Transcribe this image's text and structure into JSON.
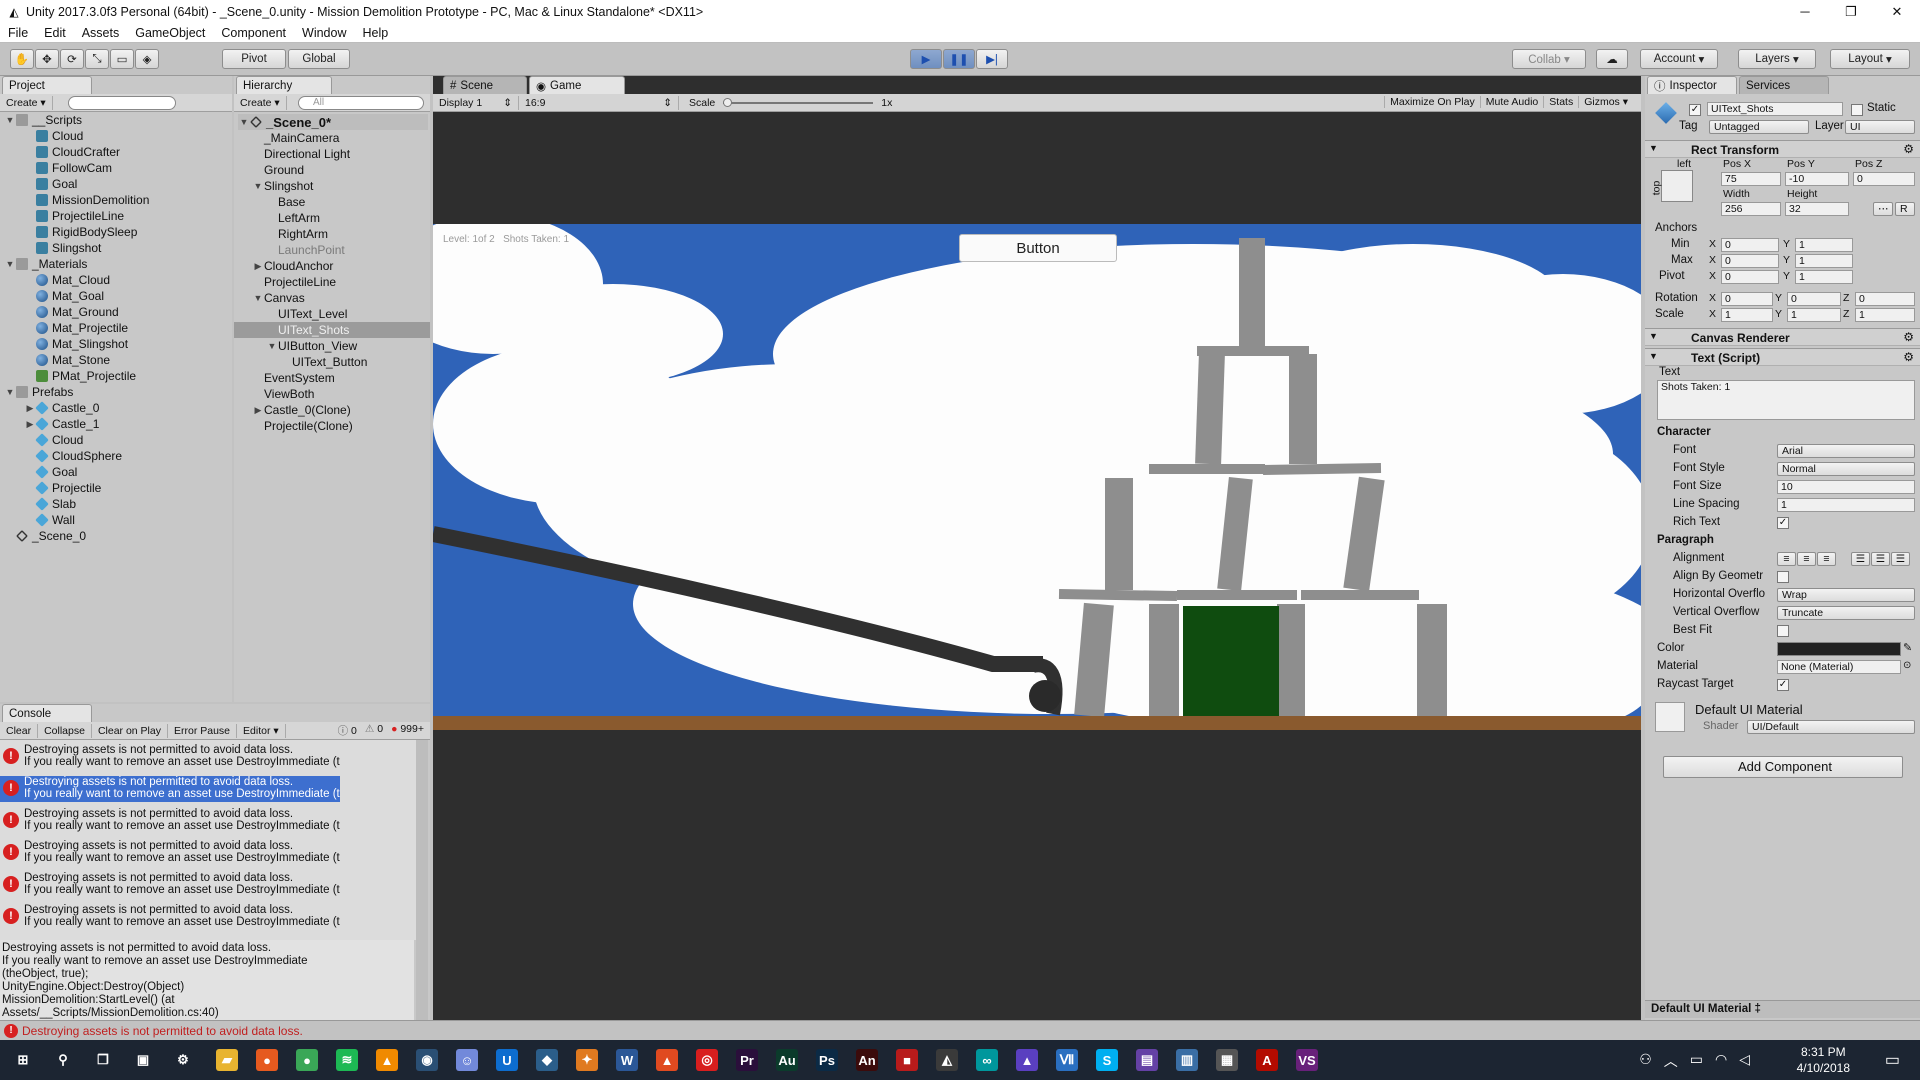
{
  "window": {
    "title": "Unity 2017.3.0f3 Personal (64bit) - _Scene_0.unity - Mission Demolition Prototype - PC, Mac & Linux Standalone* <DX11>",
    "min": "─",
    "max": "❐",
    "close": "✕"
  },
  "menu": [
    "File",
    "Edit",
    "Assets",
    "GameObject",
    "Component",
    "Window",
    "Help"
  ],
  "toolbar": {
    "pivot": "Pivot",
    "global": "Global",
    "collab": "Collab ▾",
    "account": "Account",
    "layers": "Layers",
    "layout": "Layout"
  },
  "project": {
    "tab": "Project",
    "create": "Create",
    "items": [
      {
        "label": "__Scripts",
        "icon": "folder",
        "depth": 0,
        "arrow": "▼"
      },
      {
        "label": "Cloud",
        "icon": "cs",
        "depth": 1
      },
      {
        "label": "CloudCrafter",
        "icon": "cs",
        "depth": 1
      },
      {
        "label": "FollowCam",
        "icon": "cs",
        "depth": 1
      },
      {
        "label": "Goal",
        "icon": "cs",
        "depth": 1
      },
      {
        "label": "MissionDemolition",
        "icon": "cs",
        "depth": 1
      },
      {
        "label": "ProjectileLine",
        "icon": "cs",
        "depth": 1
      },
      {
        "label": "RigidBodySleep",
        "icon": "cs",
        "depth": 1
      },
      {
        "label": "Slingshot",
        "icon": "cs",
        "depth": 1
      },
      {
        "label": "_Materials",
        "icon": "folder",
        "depth": 0,
        "arrow": "▼"
      },
      {
        "label": "Mat_Cloud",
        "icon": "mat",
        "depth": 1
      },
      {
        "label": "Mat_Goal",
        "icon": "mat",
        "depth": 1
      },
      {
        "label": "Mat_Ground",
        "icon": "mat",
        "depth": 1
      },
      {
        "label": "Mat_Projectile",
        "icon": "mat",
        "depth": 1
      },
      {
        "label": "Mat_Slingshot",
        "icon": "mat",
        "depth": 1
      },
      {
        "label": "Mat_Stone",
        "icon": "mat",
        "depth": 1
      },
      {
        "label": "PMat_Projectile",
        "icon": "pm",
        "depth": 1
      },
      {
        "label": "Prefabs",
        "icon": "folder",
        "depth": 0,
        "arrow": "▼"
      },
      {
        "label": "Castle_0",
        "icon": "pre",
        "depth": 1,
        "arrow": "▶"
      },
      {
        "label": "Castle_1",
        "icon": "pre",
        "depth": 1,
        "arrow": "▶"
      },
      {
        "label": "Cloud",
        "icon": "pre",
        "depth": 1
      },
      {
        "label": "CloudSphere",
        "icon": "pre",
        "depth": 1
      },
      {
        "label": "Goal",
        "icon": "pre",
        "depth": 1
      },
      {
        "label": "Projectile",
        "icon": "pre",
        "depth": 1
      },
      {
        "label": "Slab",
        "icon": "pre",
        "depth": 1
      },
      {
        "label": "Wall",
        "icon": "pre",
        "depth": 1
      },
      {
        "label": "_Scene_0",
        "icon": "scene",
        "depth": 0
      }
    ]
  },
  "hierarchy": {
    "tab": "Hierarchy",
    "create": "Create",
    "search": "All",
    "scene": "_Scene_0*",
    "items": [
      {
        "label": "_MainCamera",
        "depth": 1
      },
      {
        "label": "Directional Light",
        "depth": 1
      },
      {
        "label": "Ground",
        "depth": 1
      },
      {
        "label": "Slingshot",
        "depth": 1,
        "arrow": "▼"
      },
      {
        "label": "Base",
        "depth": 2
      },
      {
        "label": "LeftArm",
        "depth": 2
      },
      {
        "label": "RightArm",
        "depth": 2
      },
      {
        "label": "LaunchPoint",
        "depth": 2,
        "gray": true
      },
      {
        "label": "CloudAnchor",
        "depth": 1,
        "arrow": "▶"
      },
      {
        "label": "ProjectileLine",
        "depth": 1
      },
      {
        "label": "Canvas",
        "depth": 1,
        "arrow": "▼"
      },
      {
        "label": "UIText_Level",
        "depth": 2
      },
      {
        "label": "UIText_Shots",
        "depth": 2,
        "selected": true
      },
      {
        "label": "UIButton_View",
        "depth": 2,
        "arrow": "▼"
      },
      {
        "label": "UIText_Button",
        "depth": 3
      },
      {
        "label": "EventSystem",
        "depth": 1
      },
      {
        "label": "ViewBoth",
        "depth": 1
      },
      {
        "label": "Castle_0(Clone)",
        "depth": 1,
        "arrow": "▶"
      },
      {
        "label": "Projectile(Clone)",
        "depth": 1
      }
    ]
  },
  "console": {
    "tab": "Console",
    "buttons": [
      "Clear",
      "Collapse",
      "Clear on Play",
      "Error Pause",
      "Editor ▾"
    ],
    "counts": {
      "info": "0",
      "warn": "0",
      "error": "999+"
    },
    "line1": "Destroying assets is not permitted to avoid data loss.",
    "line2": "If you really want to remove an asset use DestroyImmediate (theO",
    "detail": [
      "Destroying assets is not permitted to avoid data loss.",
      "If you really want to remove an asset use DestroyImmediate",
      "(theObject, true);",
      "UnityEngine.Object:Destroy(Object)",
      "MissionDemolition:StartLevel() (at",
      "Assets/__Scripts/MissionDemolition.cs:40)"
    ]
  },
  "status": "Destroying assets is not permitted to avoid data loss.",
  "game": {
    "tabs": [
      "Scene",
      "Game"
    ],
    "display": "Display 1",
    "aspect": "16:9",
    "scale_label": "Scale",
    "scale_value": "1x",
    "right": [
      "Maximize On Play",
      "Mute Audio",
      "Stats",
      "Gizmos ▾"
    ],
    "level_text": "Level: 1of 2",
    "shots_text": "Shots Taken: 1",
    "button": "Button"
  },
  "inspector": {
    "tabs": [
      "Inspector",
      "Services"
    ],
    "object_name": "UIText_Shots",
    "static": "Static",
    "tag_label": "Tag",
    "tag": "Untagged",
    "layer_label": "Layer",
    "layer": "UI",
    "rect": {
      "title": "Rect Transform",
      "left": "left",
      "top": "top",
      "posx_l": "Pos X",
      "posy_l": "Pos Y",
      "posz_l": "Pos Z",
      "posx": "75",
      "posy": "-10",
      "posz": "0",
      "width_l": "Width",
      "height_l": "Height",
      "width": "256",
      "height": "32",
      "anchors": "Anchors",
      "min": "Min",
      "max": "Max",
      "pivot": "Pivot",
      "minx": "0",
      "miny": "1",
      "maxx": "0",
      "maxy": "1",
      "pivx": "0",
      "pivy": "1",
      "rotation": "Rotation",
      "rotx": "0",
      "roty": "0",
      "rotz": "0",
      "scale": "Scale",
      "scx": "1",
      "scy": "1",
      "scz": "1",
      "R": "R"
    },
    "canvas_renderer": "Canvas Renderer",
    "text": {
      "title": "Text (Script)",
      "text_label": "Text",
      "text_value": "Shots Taken: 1",
      "character": "Character",
      "font_l": "Font",
      "font": "Arial",
      "style_l": "Font Style",
      "style": "Normal",
      "size_l": "Font Size",
      "size": "10",
      "spacing_l": "Line Spacing",
      "spacing": "1",
      "rich_l": "Rich Text",
      "paragraph": "Paragraph",
      "align_l": "Alignment",
      "geom_l": "Align By Geometr",
      "hover_l": "Horizontal Overflo",
      "hover": "Wrap",
      "vover_l": "Vertical Overflow",
      "vover": "Truncate",
      "best_l": "Best Fit",
      "color_l": "Color",
      "material_l": "Material",
      "material": "None (Material)",
      "raycast_l": "Raycast Target"
    },
    "default_mat": "Default UI Material",
    "shader_l": "Shader",
    "shader": "UI/Default",
    "add_component": "Add Component",
    "footer": "Default UI Material ‡"
  },
  "taskbar": {
    "time": "8:31 PM",
    "date": "4/10/2018",
    "apps": [
      {
        "name": "windows-start",
        "glyph": "⊞",
        "color": "#1c2532"
      },
      {
        "name": "search",
        "glyph": "⚲",
        "color": "#1c2532"
      },
      {
        "name": "task-view",
        "glyph": "❐",
        "color": "#1c2532"
      },
      {
        "name": "store",
        "glyph": "▣",
        "color": "#1c2532"
      },
      {
        "name": "app-1",
        "glyph": "⚙",
        "color": "#1c2532"
      },
      {
        "name": "file-explorer",
        "glyph": "▰",
        "color": "#e8b430"
      },
      {
        "name": "firefox",
        "glyph": "●",
        "color": "#e65a1f"
      },
      {
        "name": "chrome",
        "glyph": "●",
        "color": "#3aa757"
      },
      {
        "name": "spotify",
        "glyph": "≋",
        "color": "#1db954"
      },
      {
        "name": "vlc",
        "glyph": "▲",
        "color": "#f08a00"
      },
      {
        "name": "steam",
        "glyph": "◉",
        "color": "#2a4f74"
      },
      {
        "name": "discord",
        "glyph": "☺",
        "color": "#7289da"
      },
      {
        "name": "uplay",
        "glyph": "U",
        "color": "#0d6dcf"
      },
      {
        "name": "app-2",
        "glyph": "◆",
        "color": "#2b5e8a"
      },
      {
        "name": "app-3",
        "glyph": "✦",
        "color": "#e07a20"
      },
      {
        "name": "word",
        "glyph": "W",
        "color": "#2b5797"
      },
      {
        "name": "app-4",
        "glyph": "▲",
        "color": "#e04a20"
      },
      {
        "name": "app-5",
        "glyph": "◎",
        "color": "#d81e1e"
      },
      {
        "name": "premiere",
        "glyph": "Pr",
        "color": "#2a0f3b"
      },
      {
        "name": "audition",
        "glyph": "Au",
        "color": "#0b3b2b"
      },
      {
        "name": "photoshop",
        "glyph": "Ps",
        "color": "#0b2a45"
      },
      {
        "name": "animate",
        "glyph": "An",
        "color": "#3b0b0b"
      },
      {
        "name": "app-6",
        "glyph": "■",
        "color": "#b81b1b"
      },
      {
        "name": "unity",
        "glyph": "◭",
        "color": "#3a3a3a"
      },
      {
        "name": "arduino",
        "glyph": "∞",
        "color": "#00979c"
      },
      {
        "name": "app-7",
        "glyph": "▲",
        "color": "#5a3fc0"
      },
      {
        "name": "app-8",
        "glyph": "Ⅶ",
        "color": "#2a6fc0"
      },
      {
        "name": "skype",
        "glyph": "S",
        "color": "#00aff0"
      },
      {
        "name": "twitch",
        "glyph": "▤",
        "color": "#6441a5"
      },
      {
        "name": "app-9",
        "glyph": "▥",
        "color": "#3a6ea5"
      },
      {
        "name": "app-10",
        "glyph": "▦",
        "color": "#555"
      },
      {
        "name": "acrobat",
        "glyph": "A",
        "color": "#b30b00"
      },
      {
        "name": "visual-studio",
        "glyph": "VS",
        "color": "#68217a"
      }
    ]
  }
}
